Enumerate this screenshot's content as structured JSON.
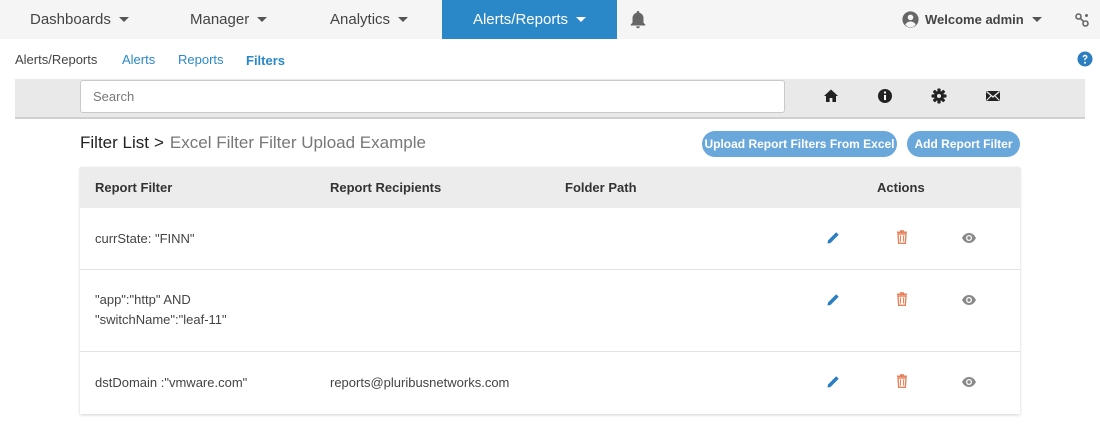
{
  "topnav": {
    "items": [
      {
        "label": "Dashboards"
      },
      {
        "label": "Manager"
      },
      {
        "label": "Analytics"
      },
      {
        "label": "Alerts/Reports"
      }
    ],
    "welcome": "Welcome admin"
  },
  "subnav": {
    "items": [
      {
        "label": "Alerts/Reports"
      },
      {
        "label": "Alerts"
      },
      {
        "label": "Reports"
      },
      {
        "label": "Filters"
      }
    ]
  },
  "search": {
    "placeholder": "Search",
    "value": ""
  },
  "page": {
    "crumb": "Filter List",
    "separator": ">",
    "subtitle": "Excel Filter Filter Upload Example",
    "upload_button": "Upload Report Filters From Excel",
    "add_button": "Add Report Filter"
  },
  "table": {
    "headers": {
      "filter": "Report Filter",
      "recipients": "Report Recipients",
      "folder": "Folder Path",
      "actions": "Actions"
    },
    "rows": [
      {
        "filter_lines": [
          "currState: \"FINN\""
        ],
        "recipients": "",
        "folder": ""
      },
      {
        "filter_lines": [
          "\"app\":\"http\" AND",
          "\"switchName\":\"leaf-11\""
        ],
        "recipients": "",
        "folder": ""
      },
      {
        "filter_lines": [
          "dstDomain :\"vmware.com\""
        ],
        "recipients": "reports@pluribusnetworks.com",
        "folder": ""
      }
    ]
  },
  "colors": {
    "accent": "#2b88c8",
    "button": "#6aa8dc",
    "link": "#2b88c8",
    "edit": "#2b7ec1",
    "delete": "#e8825c",
    "view": "#888888"
  }
}
